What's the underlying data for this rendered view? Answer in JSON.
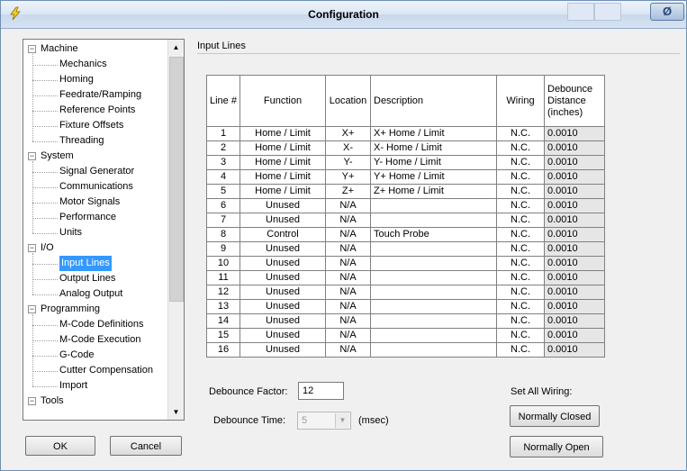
{
  "window": {
    "title": "Configuration",
    "close_label": "Ø"
  },
  "tree": {
    "groups": [
      {
        "label": "Machine",
        "items": [
          "Mechanics",
          "Homing",
          "Feedrate/Ramping",
          "Reference Points",
          "Fixture Offsets",
          "Threading"
        ]
      },
      {
        "label": "System",
        "items": [
          "Signal Generator",
          "Communications",
          "Motor Signals",
          "Performance",
          "Units"
        ]
      },
      {
        "label": "I/O",
        "items": [
          "Input Lines",
          "Output Lines",
          "Analog Output"
        ]
      },
      {
        "label": "Programming",
        "items": [
          "M-Code Definitions",
          "M-Code Execution",
          "G-Code",
          "Cutter Compensation",
          "Import"
        ]
      },
      {
        "label": "Tools",
        "items": []
      }
    ],
    "selected": "Input Lines"
  },
  "buttons": {
    "ok": "OK",
    "cancel": "Cancel",
    "normally_closed": "Normally Closed",
    "normally_open": "Normally Open"
  },
  "section_title": "Input Lines",
  "table": {
    "headers": [
      "Line #",
      "Function",
      "Location",
      "Description",
      "Wiring",
      "Debounce Distance (inches)"
    ],
    "rows": [
      [
        "1",
        "Home / Limit",
        "X+",
        "X+ Home / Limit",
        "N.C.",
        "0.0010"
      ],
      [
        "2",
        "Home / Limit",
        "X-",
        "X- Home / Limit",
        "N.C.",
        "0.0010"
      ],
      [
        "3",
        "Home / Limit",
        "Y-",
        "Y- Home / Limit",
        "N.C.",
        "0.0010"
      ],
      [
        "4",
        "Home / Limit",
        "Y+",
        "Y+ Home / Limit",
        "N.C.",
        "0.0010"
      ],
      [
        "5",
        "Home / Limit",
        "Z+",
        "Z+ Home / Limit",
        "N.C.",
        "0.0010"
      ],
      [
        "6",
        "Unused",
        "N/A",
        "",
        "N.C.",
        "0.0010"
      ],
      [
        "7",
        "Unused",
        "N/A",
        "",
        "N.C.",
        "0.0010"
      ],
      [
        "8",
        "Control",
        "N/A",
        "Touch Probe",
        "N.C.",
        "0.0010"
      ],
      [
        "9",
        "Unused",
        "N/A",
        "",
        "N.C.",
        "0.0010"
      ],
      [
        "10",
        "Unused",
        "N/A",
        "",
        "N.C.",
        "0.0010"
      ],
      [
        "11",
        "Unused",
        "N/A",
        "",
        "N.C.",
        "0.0010"
      ],
      [
        "12",
        "Unused",
        "N/A",
        "",
        "N.C.",
        "0.0010"
      ],
      [
        "13",
        "Unused",
        "N/A",
        "",
        "N.C.",
        "0.0010"
      ],
      [
        "14",
        "Unused",
        "N/A",
        "",
        "N.C.",
        "0.0010"
      ],
      [
        "15",
        "Unused",
        "N/A",
        "",
        "N.C.",
        "0.0010"
      ],
      [
        "16",
        "Unused",
        "N/A",
        "",
        "N.C.",
        "0.0010"
      ]
    ]
  },
  "debounce": {
    "factor_label": "Debounce Factor:",
    "factor_value": "12",
    "time_label": "Debounce Time:",
    "time_value": "5",
    "time_unit": "(msec)"
  },
  "set_all_wiring_label": "Set All Wiring:",
  "icons": {
    "app": "lightning-icon",
    "close": "close-icon",
    "scroll_up": "scroll-up-icon",
    "scroll_down": "scroll-down-icon",
    "combo": "chevron-down-icon"
  },
  "colors": {
    "selection": "#3399ff",
    "window_bg": "#f0f0f0",
    "titlebar": "#dbe6f4"
  }
}
